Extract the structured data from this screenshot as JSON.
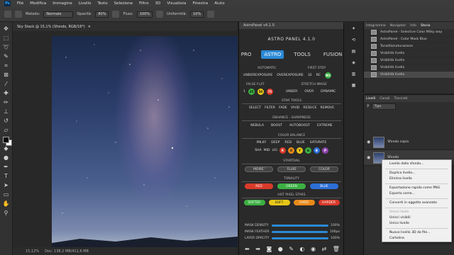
{
  "menubar": {
    "logo": "Ps",
    "items": [
      "File",
      "Modifica",
      "Immagine",
      "Livello",
      "Testo",
      "Selezione",
      "Filtro",
      "3D",
      "Visualizza",
      "Finestra",
      "Aiuto"
    ]
  },
  "options": {
    "metodo_label": "Metodo:",
    "metodo_value": "Normale",
    "opacita_label": "Opacità:",
    "opacita_value": "80%",
    "flusso_label": "Fluss:",
    "flusso_value": "100%",
    "uniformita_label": "Uniformità:",
    "uniformita_value": "10%"
  },
  "document": {
    "tab_title": "Sky Stack @ 15,1% (Sfondo, RGB/16*)",
    "zoom": "15,12%",
    "doc_info": "Doc: 138,2 MB/411,6 MB"
  },
  "astro": {
    "window_title": "AstroPanel v4.1.0",
    "title": "ASTRO PANEL 4.1.0",
    "tabs": [
      "PRO",
      "ASTRO",
      "TOOLS",
      "FUSION"
    ],
    "automatic": {
      "label": "AUTOMATIC",
      "items": [
        "UNDEREXPOSURE",
        "OVEREXPOSURE"
      ]
    },
    "first_step": {
      "label": "FIRST STEP",
      "values": [
        "32",
        "RC",
        "BG"
      ]
    },
    "false_flat": {
      "label": "FALSE FLAT",
      "values": [
        "1",
        "25",
        "50",
        "75"
      ]
    },
    "stretch": {
      "label": "STRETCH IMAGE",
      "items": [
        "UNDER",
        "OVER",
        "DYNAMIC"
      ]
    },
    "star_tools": {
      "label": "STAR TOOLS",
      "items": [
        "SELECT",
        "FILTER",
        "FADE",
        "VIVID",
        "REDUCE",
        "REMOVE"
      ]
    },
    "enhance": {
      "label": "ENHANCE - SHARPNESS",
      "items": [
        "NEBULA",
        "BOOST",
        "AUTOBOOST",
        "EXTREME"
      ]
    },
    "color_balance": {
      "label": "COLOR BALANCE",
      "items": [
        "MILKY",
        "DEEP",
        "RED",
        "BLUE",
        "SATURATE"
      ],
      "row2": [
        "SHA",
        "MID",
        "LIG",
        "R",
        "O",
        "Y",
        "G",
        "B",
        "P"
      ]
    },
    "star_trail": {
      "label": "STARTRAIL",
      "items": [
        "MOIRE'",
        "FLUID",
        "COLOR"
      ]
    },
    "tonality": {
      "label": "TONALITY",
      "items": [
        "RED",
        "GREEN",
        "BLUE"
      ]
    },
    "hot_pixel": {
      "label": "HOT PIXEL STARS",
      "items": [
        "SOFTER",
        "SOFT",
        "HARD",
        "HARDER"
      ]
    },
    "sliders": [
      {
        "label": "MASK DENSITY",
        "value": "100%",
        "fill": 1.0
      },
      {
        "label": "MASK FEATHER",
        "value": "100px",
        "fill": 1.0
      },
      {
        "label": "LAYER OPACITY",
        "value": "100%",
        "fill": 1.0
      }
    ],
    "colors": {
      "accent": "#2b8ad6",
      "red": "#d93a2a",
      "green": "#3cb043",
      "blue": "#2d6fd6",
      "yellow": "#e6c619",
      "orange": "#e88a1a"
    }
  },
  "history": {
    "tabs": [
      "Istogramma",
      "Navigator",
      "Info",
      "Storia"
    ],
    "items": [
      "AstroPanel - Selective Color Milky way",
      "AstroPanel - Color Mask Blue",
      "Tonalità/saturazione",
      "Visibilità livello",
      "Visibilità livello",
      "Visibilità livello",
      "Visibilità livello"
    ]
  },
  "layers": {
    "tabs": [
      "Livelli",
      "Canali",
      "Tracciati"
    ],
    "kind": "Tipo",
    "rows": [
      {
        "name": "Sfondo copia"
      },
      {
        "name": "Sfondo"
      }
    ]
  },
  "context_menu": {
    "items": [
      {
        "label": "Livello dallo sfondo...",
        "disabled": false
      },
      {
        "sep": true
      },
      {
        "label": "Duplica livello...",
        "disabled": false
      },
      {
        "label": "Elimina livello",
        "disabled": false
      },
      {
        "sep": true
      },
      {
        "label": "Esportazione rapida come PNG",
        "disabled": false
      },
      {
        "label": "Esporta come...",
        "disabled": false
      },
      {
        "sep": true
      },
      {
        "label": "Converti in oggetto avanzato",
        "disabled": false
      },
      {
        "sep": true
      },
      {
        "label": "Unisci livelli",
        "disabled": true
      },
      {
        "label": "Unisci visibili",
        "disabled": false
      },
      {
        "label": "Unico livello",
        "disabled": false
      },
      {
        "sep": true
      },
      {
        "label": "Nuovo livello 3D da file...",
        "disabled": false
      },
      {
        "label": "Cartolina",
        "disabled": false
      }
    ]
  }
}
